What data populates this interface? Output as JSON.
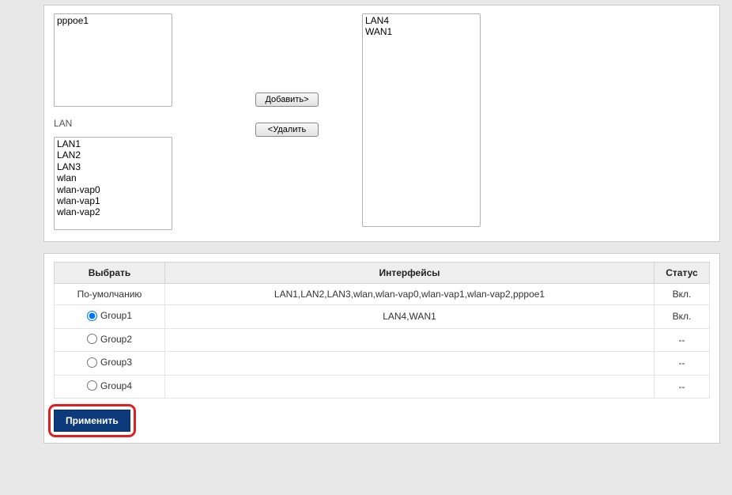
{
  "picker": {
    "wan_options": [
      "pppoe1"
    ],
    "lan_label": "LAN",
    "lan_options": [
      "LAN1",
      "LAN2",
      "LAN3",
      "wlan",
      "wlan-vap0",
      "wlan-vap1",
      "wlan-vap2"
    ],
    "selected_options": [
      "LAN4",
      "WAN1"
    ],
    "add_label": "Добавить>",
    "remove_label": "<Удалить"
  },
  "groups_table": {
    "headers": {
      "select": "Выбрать",
      "interfaces": "Интерфейсы",
      "status": "Статус"
    },
    "rows": [
      {
        "label": "По-умолчанию",
        "radio": false,
        "interfaces": "LAN1,LAN2,LAN3,wlan,wlan-vap0,wlan-vap1,wlan-vap2,pppoe1",
        "status": "Вкл."
      },
      {
        "label": "Group1",
        "radio": true,
        "checked": true,
        "interfaces": "LAN4,WAN1",
        "status": "Вкл."
      },
      {
        "label": "Group2",
        "radio": true,
        "checked": false,
        "interfaces": "",
        "status": "--"
      },
      {
        "label": "Group3",
        "radio": true,
        "checked": false,
        "interfaces": "",
        "status": "--"
      },
      {
        "label": "Group4",
        "radio": true,
        "checked": false,
        "interfaces": "",
        "status": "--"
      }
    ]
  },
  "apply_label": "Применить"
}
